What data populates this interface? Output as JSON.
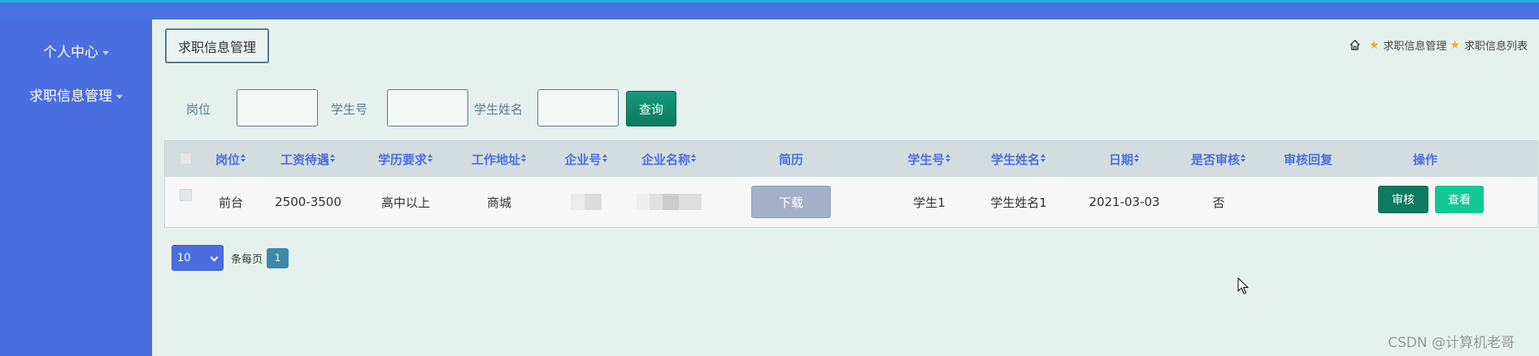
{
  "sidebar": {
    "items": [
      {
        "label": "个人中心"
      },
      {
        "label": "求职信息管理"
      }
    ]
  },
  "header": {
    "title_button": "求职信息管理",
    "breadcrumb": [
      "求职信息管理",
      "求职信息列表"
    ]
  },
  "search": {
    "fields": [
      {
        "label": "岗位",
        "value": ""
      },
      {
        "label": "学生号",
        "value": ""
      },
      {
        "label": "学生姓名",
        "value": ""
      }
    ],
    "query_label": "查询"
  },
  "table": {
    "columns": [
      "岗位",
      "工资待遇",
      "学历要求",
      "工作地址",
      "企业号",
      "企业名称",
      "简历",
      "学生号",
      "学生姓名",
      "日期",
      "是否审核",
      "审核回复",
      "操作"
    ],
    "rows": [
      {
        "post": "前台",
        "salary": "2500-3500",
        "education": "高中以上",
        "address": "商城",
        "resume_button": "下载",
        "student_no": "学生1",
        "student_name": "学生姓名1",
        "date": "2021-03-03",
        "audited": "否",
        "audit_reply": "",
        "audit_button": "审核",
        "view_button": "查看"
      }
    ]
  },
  "pager": {
    "page_size": "10",
    "per_page_label": "条每页",
    "current_page": "1"
  },
  "watermark": "CSDN @计算机老哥",
  "colors": {
    "sidebar": "#4a6ee0",
    "header_text": "#4a6ee0",
    "query_button": "#0d7a5e",
    "view_button": "#12c994",
    "background": "#e6f1ee"
  }
}
